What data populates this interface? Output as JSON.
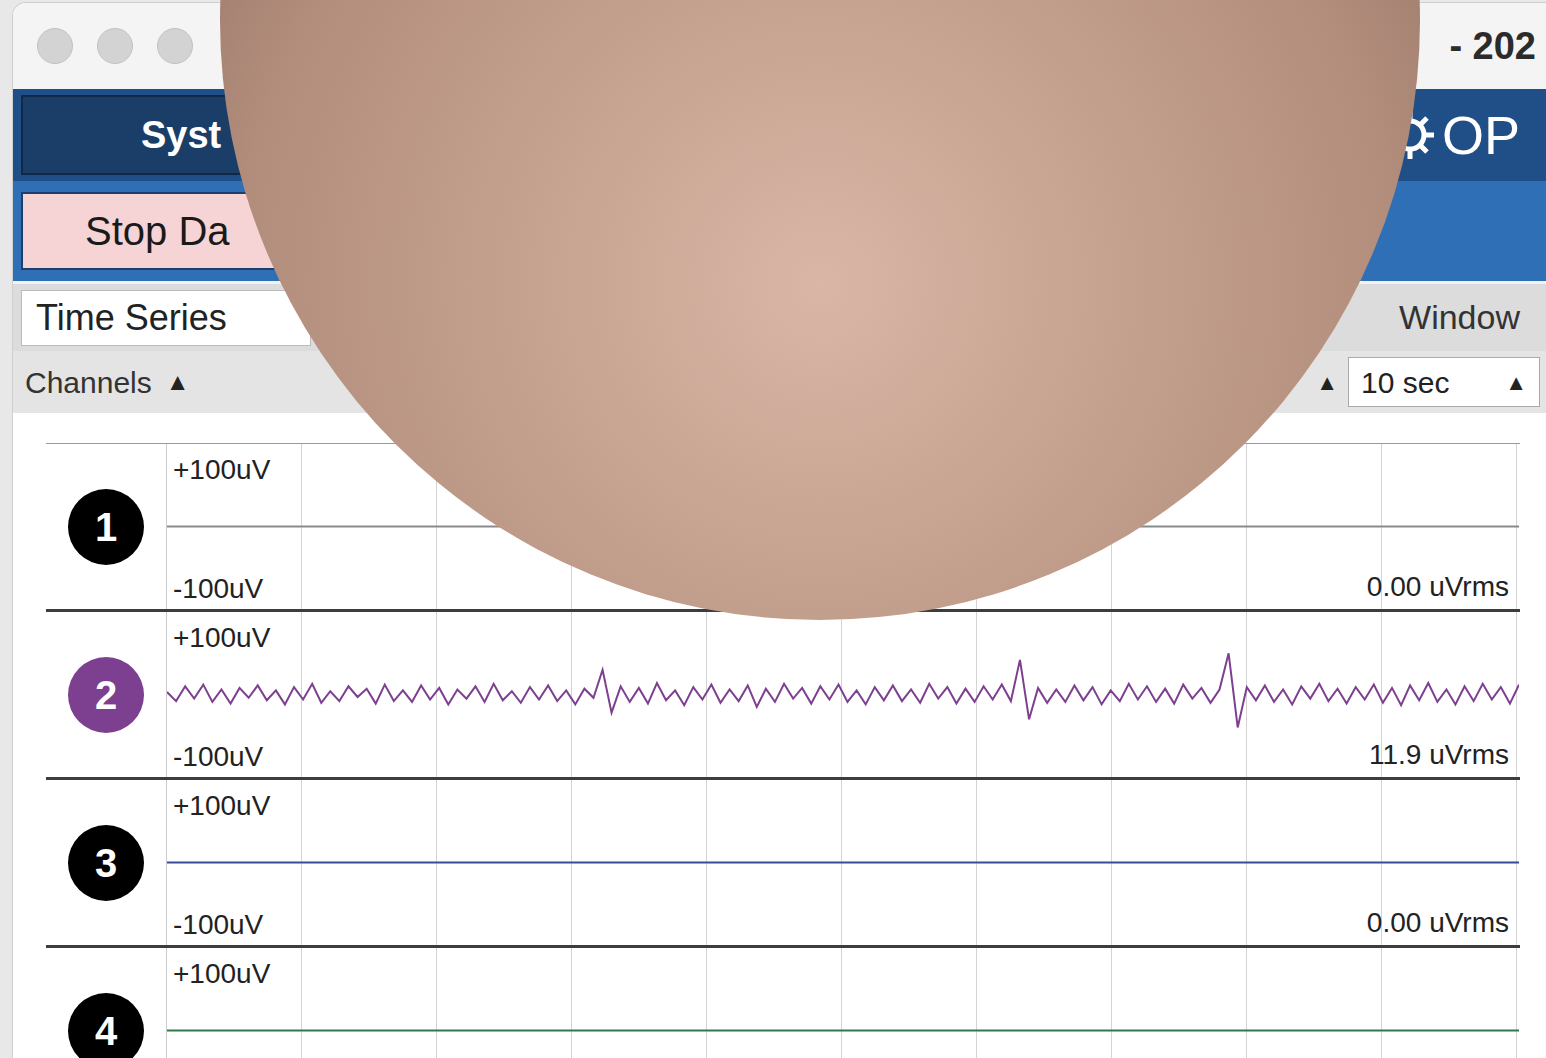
{
  "window": {
    "title": "- 202"
  },
  "toolbar": {
    "system_button": "Syst",
    "logo": "OP",
    "stop_button": "Stop Da"
  },
  "widget": {
    "tab": "Time Series",
    "window_label": "Window",
    "channels_label": "Channels",
    "channels_arrow": "▲",
    "dropdown_arrow": "▲",
    "window_value": "10 sec",
    "window_arrow": "▲"
  },
  "chart": {
    "channels": [
      {
        "number": "1",
        "selected": false,
        "color": "#8a8a8a",
        "scale_top": "+100uV",
        "scale_bottom": "-100uV",
        "rms": "0.00 uVrms",
        "values": [
          0,
          0
        ]
      },
      {
        "number": "2",
        "selected": true,
        "color": "#7d3f8f",
        "scale_top": "+100uV",
        "scale_bottom": "-100uV",
        "rms": "11.9 uVrms",
        "values": [
          3,
          -8,
          10,
          -5,
          12,
          -9,
          6,
          -11,
          8,
          -4,
          11,
          -7,
          5,
          -12,
          9,
          -6,
          13,
          -10,
          4,
          -8,
          10,
          -3,
          7,
          -11,
          12,
          -8,
          5,
          -9,
          11,
          -6,
          8,
          -12,
          6,
          -5,
          10,
          -9,
          13,
          -7,
          4,
          -10,
          9,
          -6,
          11,
          -8,
          5,
          -12,
          7,
          -4,
          30,
          -22,
          10,
          -9,
          8,
          -11,
          14,
          -7,
          5,
          -13,
          9,
          -6,
          12,
          -10,
          6,
          -8,
          11,
          -15,
          7,
          -9,
          13,
          -5,
          8,
          -11,
          10,
          -6,
          12,
          -9,
          5,
          -12,
          9,
          -7,
          11,
          -8,
          6,
          -10,
          13,
          -5,
          9,
          -11,
          7,
          -9,
          10,
          -6,
          12,
          -8,
          42,
          -30,
          8,
          -10,
          6,
          -9,
          11,
          -7,
          9,
          -12,
          5,
          -8,
          13,
          -6,
          10,
          -9,
          7,
          -11,
          12,
          -5,
          8,
          -10,
          6,
          50,
          -40,
          9,
          -7,
          11,
          -9,
          6,
          -12,
          10,
          -5,
          13,
          -8,
          7,
          -11,
          9,
          -6,
          12,
          -10,
          8,
          -13,
          11,
          -7,
          14,
          -9,
          6,
          -12,
          10,
          -8,
          13,
          -6,
          9,
          -11,
          12
        ]
      },
      {
        "number": "3",
        "selected": false,
        "color": "#3a4a9a",
        "scale_top": "+100uV",
        "scale_bottom": "-100uV",
        "rms": "0.00 uVrms",
        "values": [
          0,
          0
        ]
      },
      {
        "number": "4",
        "selected": false,
        "color": "#2f7a4a",
        "scale_top": "+100uV",
        "values": [
          0,
          0
        ]
      }
    ]
  }
}
